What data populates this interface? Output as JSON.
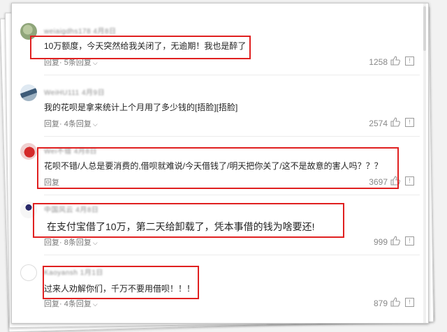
{
  "colors": {
    "highlight_box": "#e02020",
    "text": "#222222",
    "meta_text": "#777777"
  },
  "comments": [
    {
      "avatar": "round-avatar-green",
      "text": "10万额度，今天突然给我关闭了，无逾期！我也是醉了",
      "reply_label": "回复",
      "replies_label": "· 5条回复",
      "likes": "1258"
    },
    {
      "avatar": "round-avatar-car",
      "text": "我的花呗是拿来统计上个月用了多少钱的[捂脸][捂脸]",
      "reply_label": "回复",
      "replies_label": "· 4条回复",
      "likes": "2574"
    },
    {
      "avatar": "round-avatar-red",
      "text": "花呗不错/人总是要消费的,借呗就难说/今天借钱了/明天把你关了/这不是故意的害人吗？？？",
      "reply_label": "回复",
      "replies_label": "",
      "likes": "3697"
    },
    {
      "avatar": "round-avatar-figure",
      "text": "在支付宝借了10万，第二天给卸载了，凭本事借的钱为啥要还!",
      "reply_label": "回复",
      "replies_label": "· 8条回复",
      "likes": "999"
    },
    {
      "avatar": "round-avatar-blank",
      "text": "过来人劝解你们，千万不要用借呗！！！",
      "reply_label": "回复",
      "replies_label": "· 4条回复",
      "likes": "879"
    }
  ]
}
